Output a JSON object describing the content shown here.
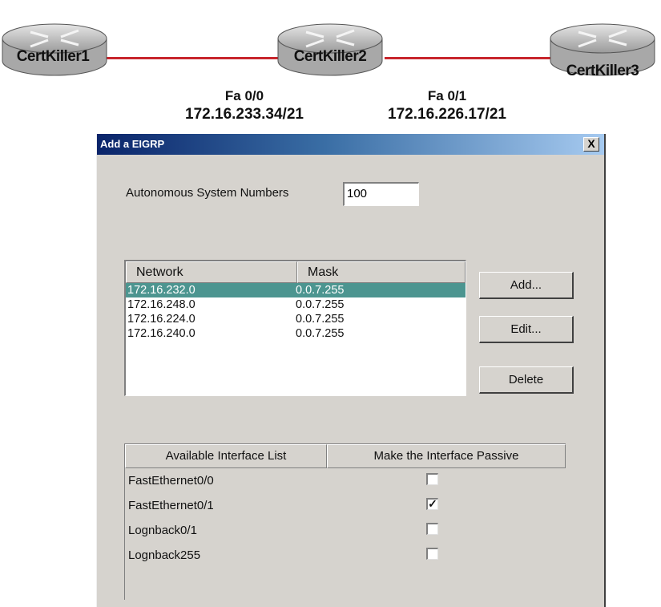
{
  "topology": {
    "routers": [
      {
        "label": "CertKiller1"
      },
      {
        "label": "CertKiller2"
      },
      {
        "label": "CertKiller3"
      }
    ],
    "interfaces": [
      {
        "name": "Fa 0/0",
        "address": "172.16.233.34/21"
      },
      {
        "name": "Fa 0/1",
        "address": "172.16.226.17/21"
      }
    ],
    "link_color": "#c8262d"
  },
  "dialog": {
    "title": "Add a EIGRP",
    "close_label": "X",
    "as_label": "Autonomous System Numbers",
    "as_value": "100",
    "network_table": {
      "headers": [
        "Network",
        "Mask"
      ],
      "rows": [
        {
          "network": "172.16.232.0",
          "mask": "0.0.7.255",
          "selected": true
        },
        {
          "network": "172.16.248.0",
          "mask": "0.0.7.255",
          "selected": false
        },
        {
          "network": "172.16.224.0",
          "mask": "0.0.7.255",
          "selected": false
        },
        {
          "network": "172.16.240.0",
          "mask": "0.0.7.255",
          "selected": false
        }
      ]
    },
    "buttons": {
      "add": "Add...",
      "edit": "Edit...",
      "delete": "Delete"
    },
    "interface_table": {
      "headers": [
        "Available Interface List",
        "Make the Interface Passive"
      ],
      "rows": [
        {
          "name": "FastEthernet0/0",
          "passive": false
        },
        {
          "name": "FastEthernet0/1",
          "passive": true
        },
        {
          "name": "Lognback0/1",
          "passive": false
        },
        {
          "name": "Lognback255",
          "passive": false
        }
      ]
    },
    "selection_color": "#4c9590",
    "titlebar_color": "#0a246a"
  }
}
